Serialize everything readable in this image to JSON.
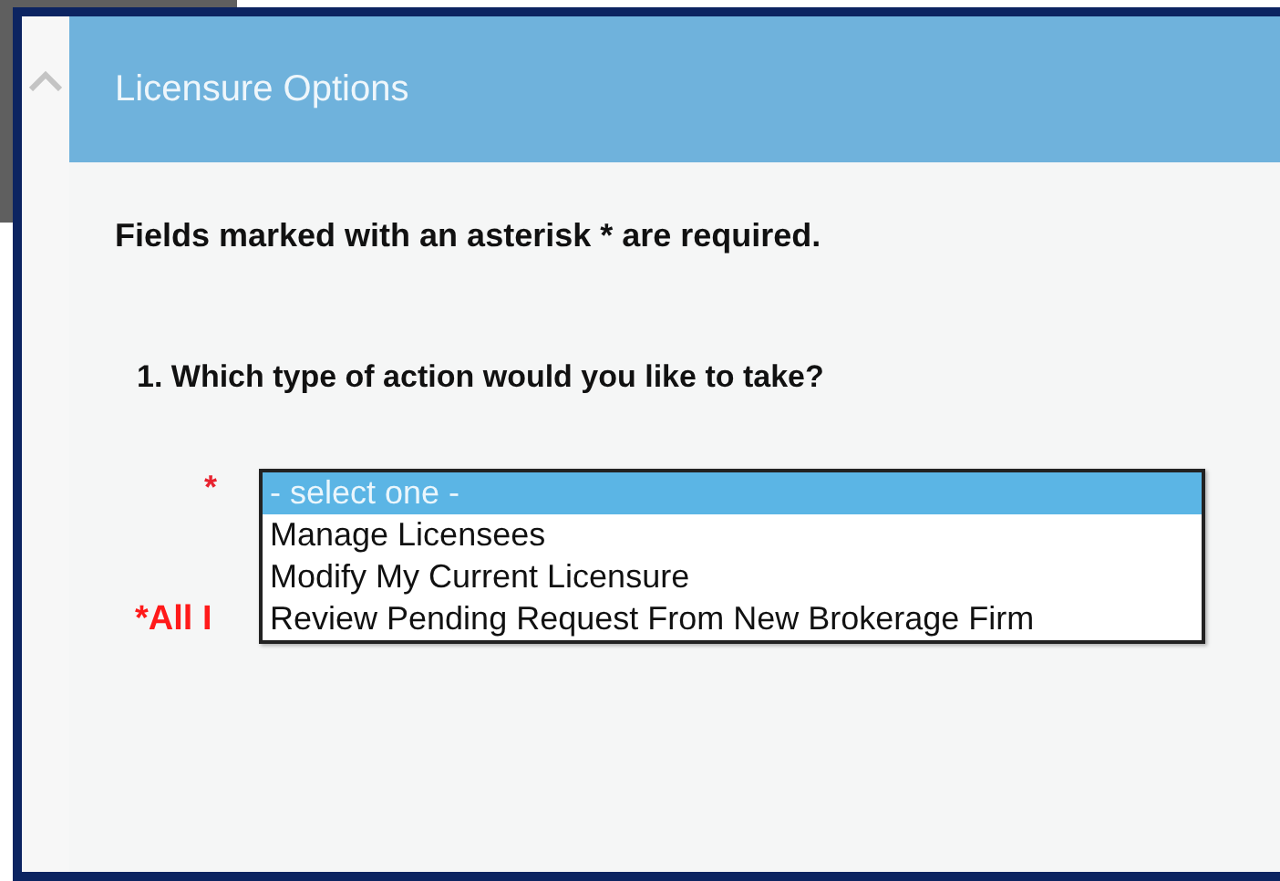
{
  "panel": {
    "title": "Licensure Options",
    "required_note": "Fields marked with an asterisk * are required.",
    "question": "1. Which type of action would you like to take?",
    "required_mark": "*",
    "error_note": "*All I",
    "dropdown": {
      "expanded": true,
      "options": [
        {
          "label": "- select one -",
          "selected": true
        },
        {
          "label": "Manage Licensees",
          "selected": false
        },
        {
          "label": "Modify My Current Licensure",
          "selected": false
        },
        {
          "label": "Review Pending Request From New Brokerage Firm",
          "selected": false
        }
      ]
    }
  }
}
